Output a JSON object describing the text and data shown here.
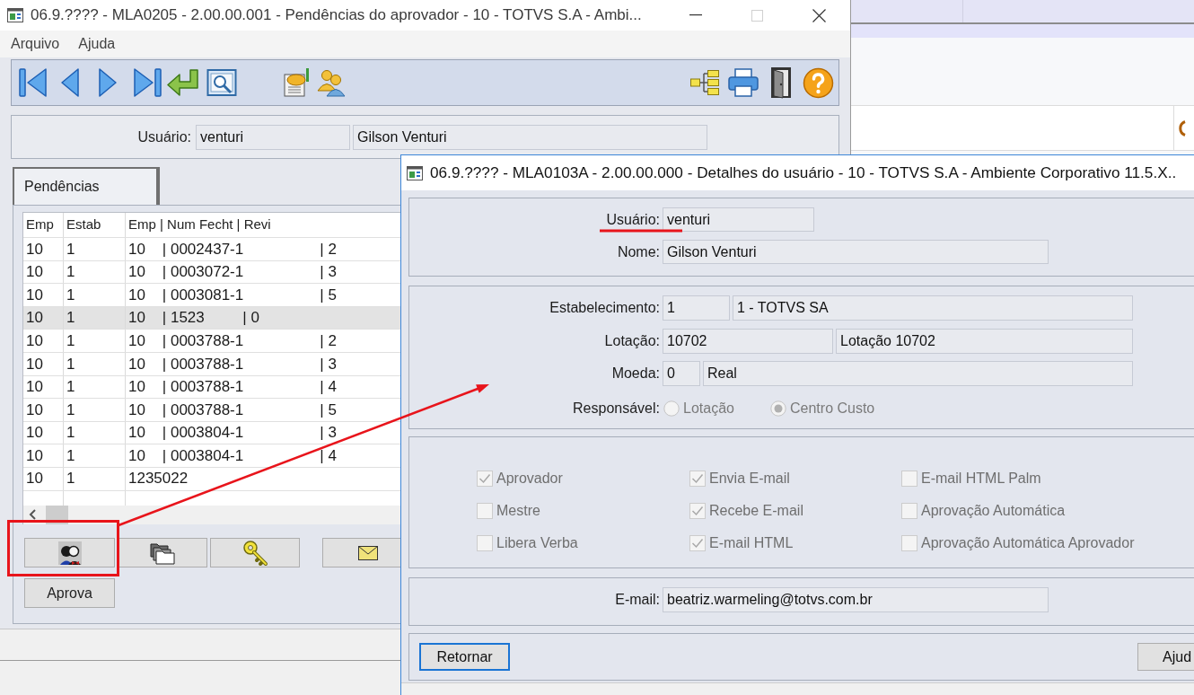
{
  "main_window": {
    "title": "06.9.???? - MLA0205 - 2.00.00.001 - Pendências do aprovador - 10 - TOTVS S.A - Ambi...",
    "maximize_disabled": true,
    "menu": [
      "Arquivo",
      "Ajuda"
    ],
    "user": {
      "label": "Usuário:",
      "login": "venturi",
      "name": "Gilson Venturi"
    },
    "tabs": [
      {
        "label": "Pendências",
        "selected": true
      }
    ],
    "table": {
      "columns": [
        "Emp",
        "Estab",
        "Emp | Num Fecht | Revi"
      ],
      "rows": [
        {
          "cells": [
            "10",
            "1",
            "10    | 0002437-1                  | 2"
          ],
          "selected": false
        },
        {
          "cells": [
            "10",
            "1",
            "10    | 0003072-1                  | 3"
          ],
          "selected": false
        },
        {
          "cells": [
            "10",
            "1",
            "10    | 0003081-1                  | 5"
          ],
          "selected": false
        },
        {
          "cells": [
            "10",
            "1",
            "10    | 1523         | 0"
          ],
          "selected": true
        },
        {
          "cells": [
            "10",
            "1",
            "10    | 0003788-1                  | 2"
          ],
          "selected": false
        },
        {
          "cells": [
            "10",
            "1",
            "10    | 0003788-1                  | 3"
          ],
          "selected": false
        },
        {
          "cells": [
            "10",
            "1",
            "10    | 0003788-1                  | 4"
          ],
          "selected": false
        },
        {
          "cells": [
            "10",
            "1",
            "10    | 0003788-1                  | 5"
          ],
          "selected": false
        },
        {
          "cells": [
            "10",
            "1",
            "10    | 0003804-1                  | 3"
          ],
          "selected": false
        },
        {
          "cells": [
            "10",
            "1",
            "10    | 0003804-1                  | 4"
          ],
          "selected": false
        },
        {
          "cells": [
            "10",
            "1",
            "1235022"
          ],
          "selected": false
        }
      ]
    },
    "approve_button": "Aprova"
  },
  "details_dialog": {
    "title": "06.9.???? - MLA0103A - 2.00.00.000 - Detalhes do usuário - 10 - TOTVS S.A - Ambiente Corporativo 11.5.X..",
    "identity": [
      {
        "label": "Usuário:",
        "value": "venturi"
      },
      {
        "label": "Nome:",
        "value": "Gilson Venturi"
      }
    ],
    "lookups": [
      {
        "label": "Estabelecimento:",
        "code": "1",
        "description": "1 - TOTVS SA"
      },
      {
        "label": "Lotação:",
        "code": "10702",
        "description": "Lotação 10702"
      },
      {
        "label": "Moeda:",
        "code": "0",
        "description": "Real"
      }
    ],
    "responsible": {
      "label": "Responsável:",
      "disabled": true,
      "options": [
        {
          "label": "Lotação",
          "selected": false
        },
        {
          "label": "Centro Custo",
          "selected": true
        }
      ]
    },
    "flags": {
      "disabled": true,
      "options": [
        {
          "label": "Aprovador",
          "checked": true
        },
        {
          "label": "Envia E-mail",
          "checked": true
        },
        {
          "label": "E-mail HTML Palm",
          "checked": false
        },
        {
          "label": "Mestre",
          "checked": false
        },
        {
          "label": "Recebe E-mail",
          "checked": true
        },
        {
          "label": "Aprovação Automática",
          "checked": false
        },
        {
          "label": "Libera Verba",
          "checked": false
        },
        {
          "label": "E-mail HTML",
          "checked": true
        },
        {
          "label": "Aprovação Automática Aprovador",
          "checked": false
        }
      ]
    },
    "email": {
      "label": "E-mail:",
      "value": "beatriz.warmeling@totvs.com.br"
    },
    "buttons": [
      {
        "label": "Retornar",
        "focused": true
      },
      {
        "label": "Ajud",
        "focused": false
      }
    ]
  }
}
